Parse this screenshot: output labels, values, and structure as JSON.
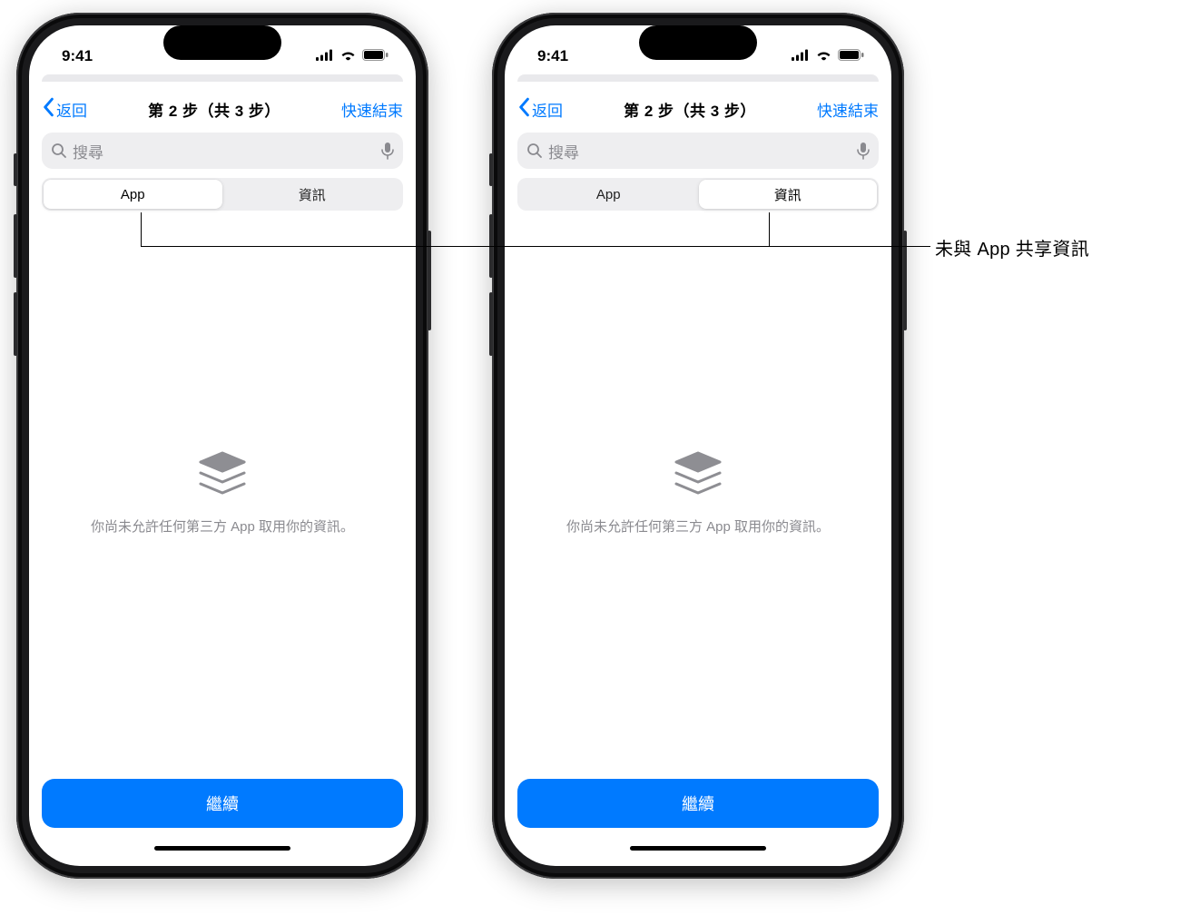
{
  "status": {
    "time": "9:41"
  },
  "nav": {
    "back_label": "返回",
    "title": "第 2 步（共 3 步）",
    "action_label": "快速結束"
  },
  "search": {
    "placeholder": "搜尋"
  },
  "segments": {
    "app": "App",
    "info": "資訊"
  },
  "empty": {
    "message": "你尚未允許任何第三方 App 取用你的資訊。"
  },
  "footer": {
    "continue_label": "繼續"
  },
  "phones": {
    "left": {
      "selected_segment": "app"
    },
    "right": {
      "selected_segment": "info"
    }
  },
  "callout": {
    "label": "未與 App 共享資訊"
  }
}
